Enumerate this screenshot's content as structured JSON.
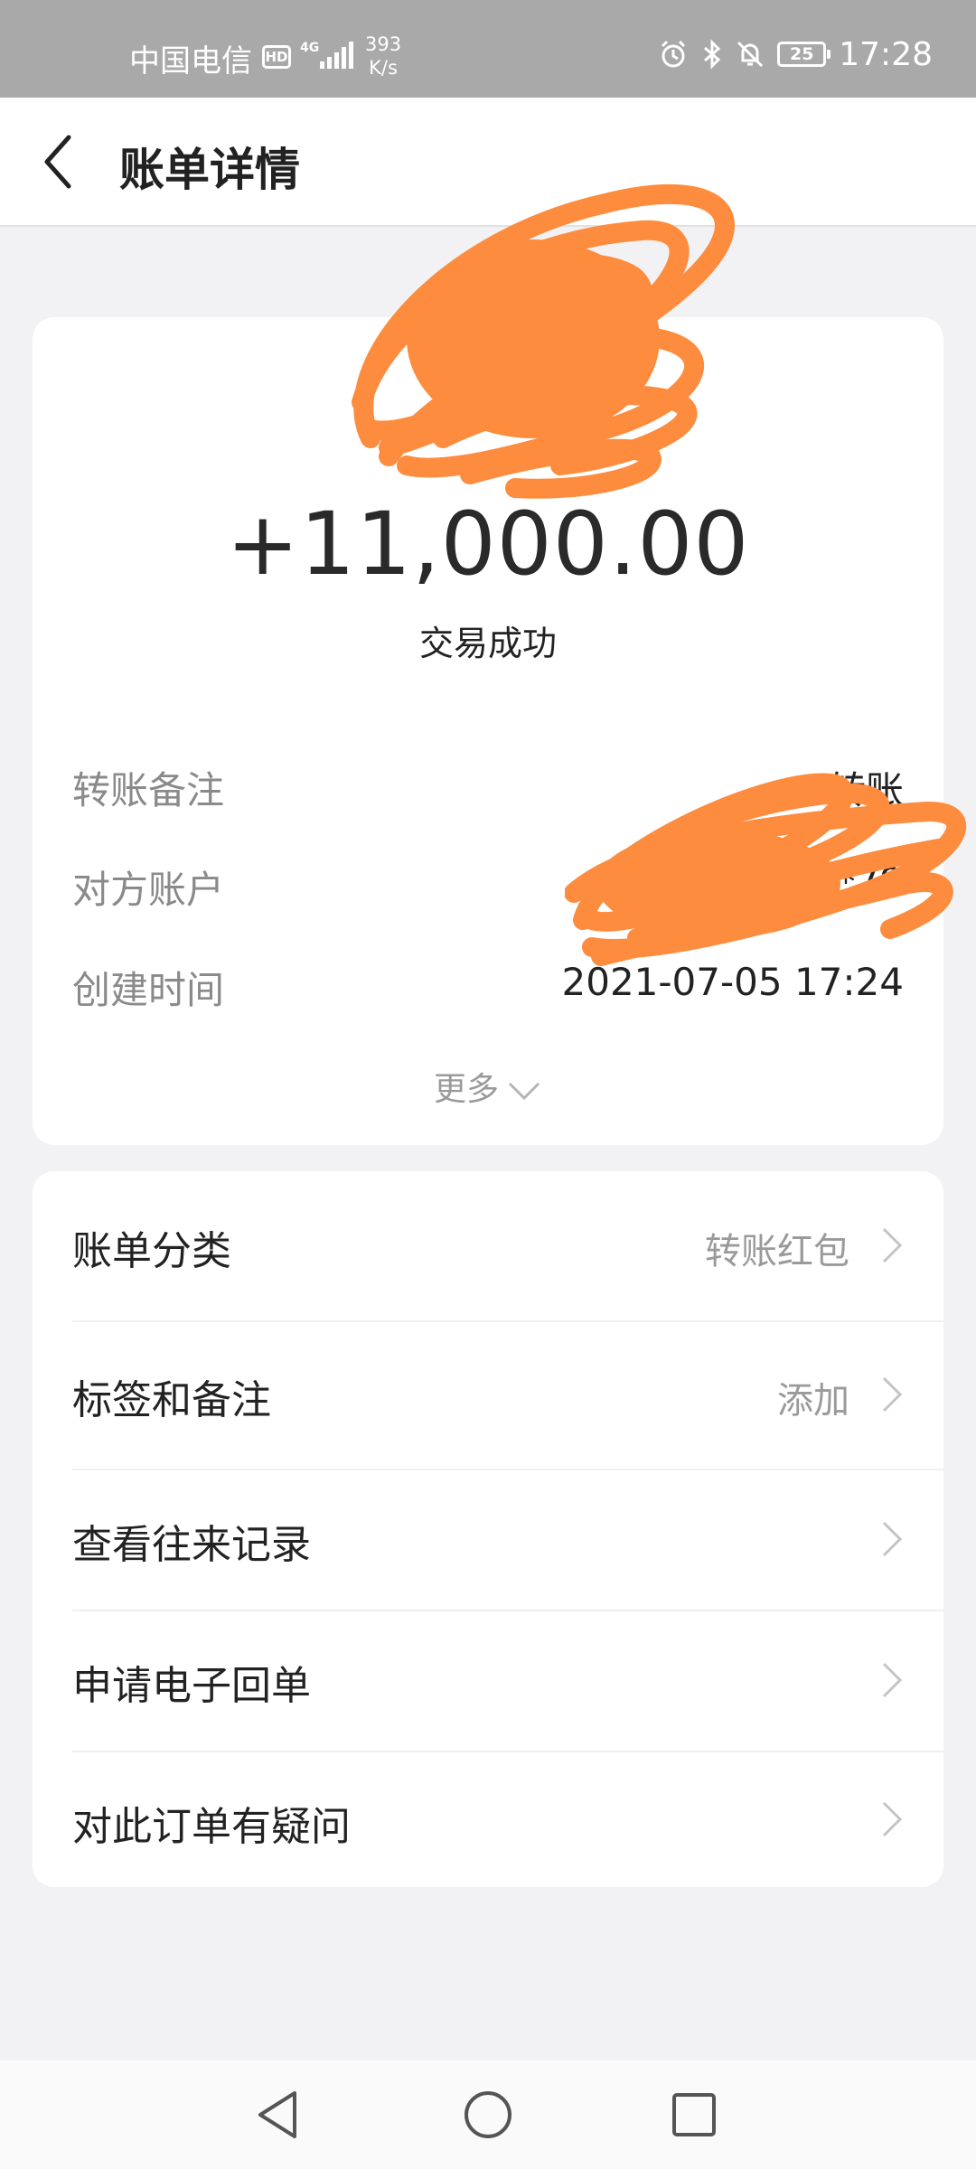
{
  "status_bar": {
    "carrier": "中国电信",
    "hd": "HD",
    "network": "4G",
    "speed_value": "393",
    "speed_unit": "K/s",
    "battery": "25",
    "time": "17:28"
  },
  "header": {
    "title": "账单详情"
  },
  "summary": {
    "amount": "+11,000.00",
    "status": "交易成功",
    "rows": [
      {
        "label": "转账备注",
        "value": "转账"
      },
      {
        "label": "对方账户",
        "value": "**79"
      },
      {
        "label": "创建时间",
        "value": "2021-07-05 17:24"
      }
    ],
    "more_label": "更多"
  },
  "actions": [
    {
      "label": "账单分类",
      "value": "转账红包"
    },
    {
      "label": "标签和备注",
      "value": "添加"
    },
    {
      "label": "查看往来记录",
      "value": ""
    },
    {
      "label": "申请电子回单",
      "value": ""
    },
    {
      "label": "对此订单有疑问",
      "value": ""
    }
  ],
  "colors": {
    "redaction_scribble": "#fd8c3e",
    "status_bar": "#a9a9a9",
    "page_background": "#f2f2f4"
  }
}
